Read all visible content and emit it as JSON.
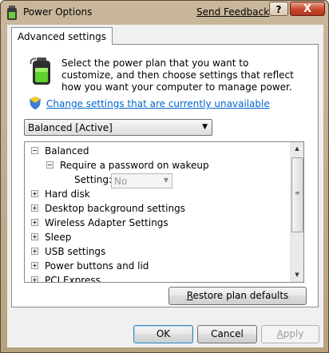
{
  "window": {
    "title": "Power Options",
    "send_feedback": "Send Feedback",
    "help_label": "?",
    "close_label": "X"
  },
  "tabs": [
    {
      "label": "Advanced settings",
      "selected": true
    }
  ],
  "description": "Select the power plan that you want to customize, and then choose settings that reflect how you want your computer to manage power.",
  "change_settings_link": "Change settings that are currently unavailable",
  "plan_select": {
    "value": "Balanced [Active]"
  },
  "tree": {
    "root": "Balanced",
    "sub": "Require a password on wakeup",
    "setting_label": "Setting:",
    "setting_value": "No",
    "items": [
      "Hard disk",
      "Desktop background settings",
      "Wireless Adapter Settings",
      "Sleep",
      "USB settings",
      "Power buttons and lid",
      "PCI Express"
    ]
  },
  "buttons": {
    "restore": {
      "prefix": "",
      "accel": "R",
      "rest": "estore plan defaults"
    },
    "ok": "OK",
    "cancel": "Cancel",
    "apply": {
      "accel": "A",
      "rest": "pply"
    }
  },
  "colors": {
    "link": "#0066cc",
    "frame": "#c9b79c"
  }
}
